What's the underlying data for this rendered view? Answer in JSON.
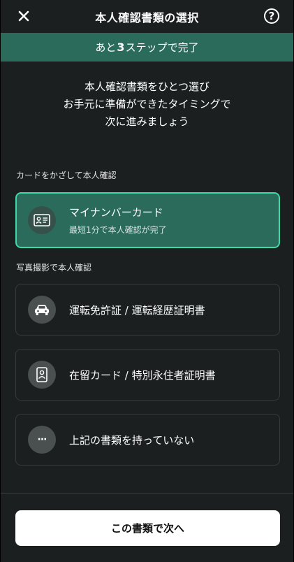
{
  "header": {
    "title": "本人確認書類の選択",
    "help_glyph": "?"
  },
  "step_banner": {
    "prefix": "あと",
    "count": "3",
    "suffix": "ステップで完了"
  },
  "intro": {
    "line1": "本人確認書類をひとつ選び",
    "line2": "お手元に準備ができたタイミングで",
    "line3": "次に進みましょう"
  },
  "sections": {
    "card_scan_label": "カードをかざして本人確認",
    "photo_label": "写真撮影で本人確認"
  },
  "options": {
    "my_number": {
      "label": "マイナンバーカード",
      "sub": "最短1分で本人確認が完了",
      "icon": "id-card-icon"
    },
    "drivers_license": {
      "label": "運転免許証 / 運転経歴証明書",
      "icon": "car-icon"
    },
    "residence_card": {
      "label": "在留カード / 特別永住者証明書",
      "icon": "id-badge-icon"
    },
    "none": {
      "label": "上記の書類を持っていない",
      "icon": "more-icon",
      "glyph": "···"
    }
  },
  "footer": {
    "next_label": "この書類で次へ"
  },
  "colors": {
    "background": "#1b1f1f",
    "accent": "#2a6b5c",
    "selected_border": "#3fd9a7"
  }
}
